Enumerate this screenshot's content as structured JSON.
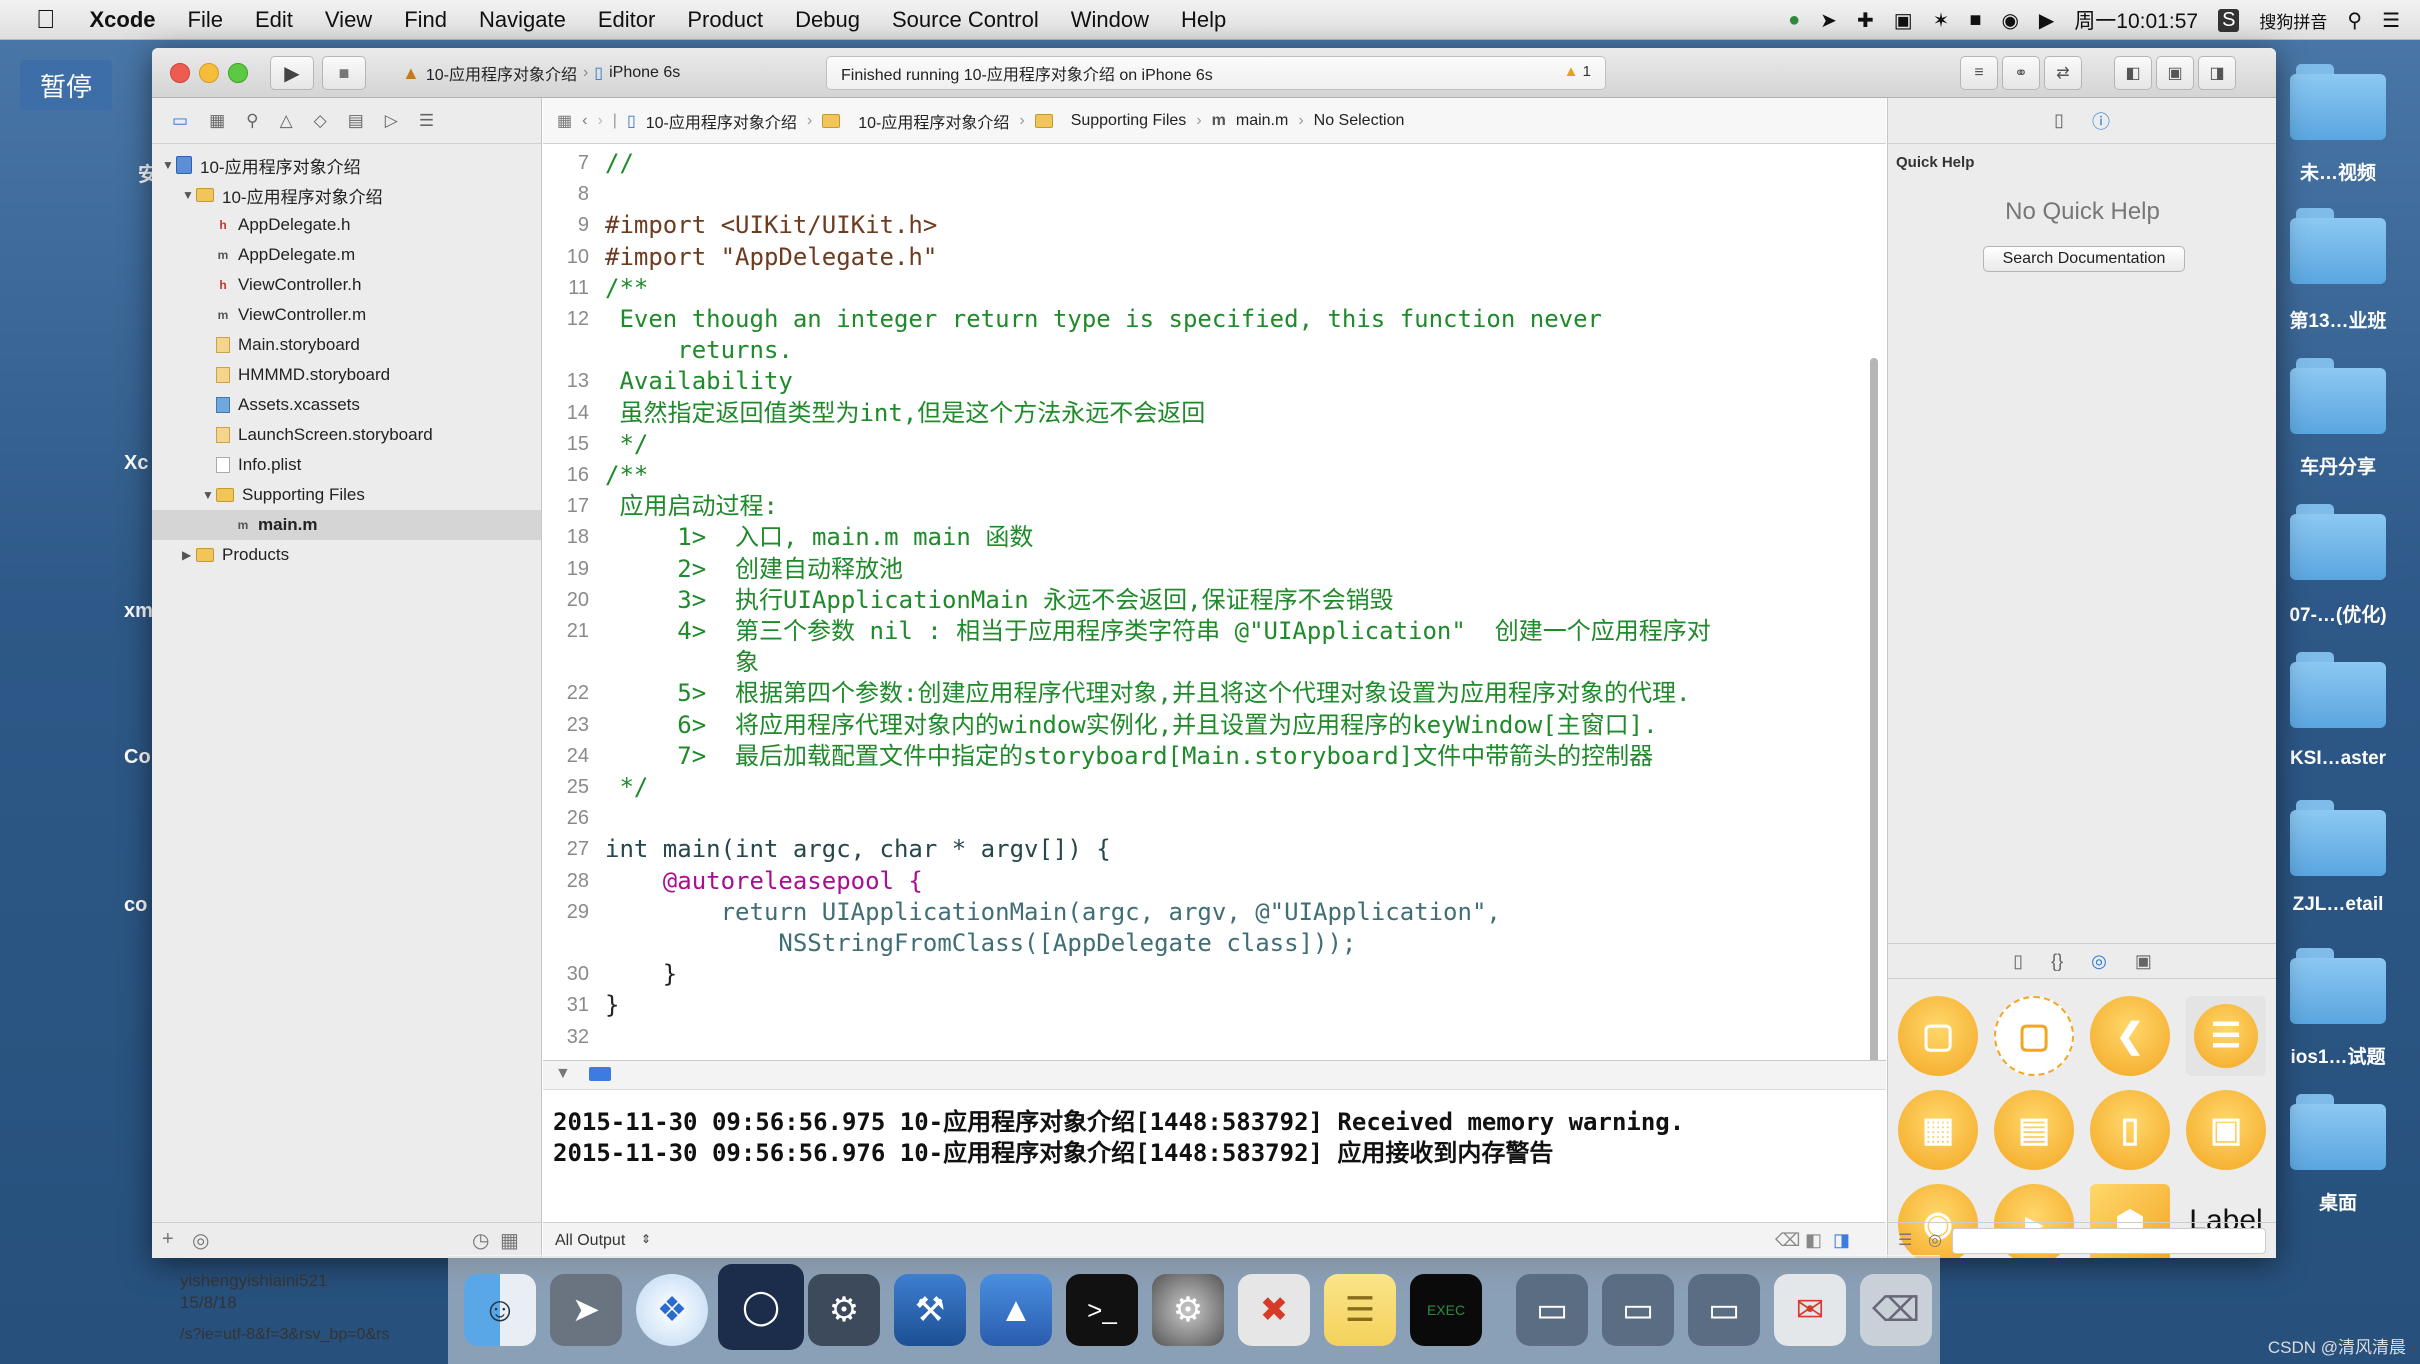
{
  "menubar": {
    "app_name": "Xcode",
    "items": [
      "File",
      "Edit",
      "View",
      "Find",
      "Navigate",
      "Editor",
      "Product",
      "Debug",
      "Source Control",
      "Window",
      "Help"
    ],
    "clock": "周一10:01:57",
    "input_method": "搜狗拼音"
  },
  "desktop": {
    "pause_badge": "暂停",
    "left_labels": [
      "安",
      "Xc",
      "xm",
      "Co",
      "co"
    ],
    "folders": [
      "未…视频",
      "第13…业班",
      "车丹分享",
      "07-…(优化)",
      "KSI…aster",
      "ZJL…etail",
      "ios1…试题",
      "桌面"
    ]
  },
  "toolbar": {
    "scheme_project": "10-应用程序对象介绍",
    "scheme_device": "iPhone 6s",
    "activity_status": "Finished running 10-应用程序对象介绍 on iPhone 6s",
    "warning_count": "1"
  },
  "navigator": {
    "tree": [
      {
        "label": "10-应用程序对象介绍",
        "kind": "project",
        "level": 0,
        "expanded": true
      },
      {
        "label": "10-应用程序对象介绍",
        "kind": "folder",
        "level": 1,
        "expanded": true
      },
      {
        "label": "AppDelegate.h",
        "kind": "h",
        "level": 2
      },
      {
        "label": "AppDelegate.m",
        "kind": "m",
        "level": 2
      },
      {
        "label": "ViewController.h",
        "kind": "h",
        "level": 2
      },
      {
        "label": "ViewController.m",
        "kind": "m",
        "level": 2
      },
      {
        "label": "Main.storyboard",
        "kind": "storyboard",
        "level": 2
      },
      {
        "label": "HMMMD.storyboard",
        "kind": "storyboard",
        "level": 2
      },
      {
        "label": "Assets.xcassets",
        "kind": "assets",
        "level": 2
      },
      {
        "label": "LaunchScreen.storyboard",
        "kind": "storyboard",
        "level": 2
      },
      {
        "label": "Info.plist",
        "kind": "plist",
        "level": 2
      },
      {
        "label": "Supporting Files",
        "kind": "folder",
        "level": 2,
        "expanded": true
      },
      {
        "label": "main.m",
        "kind": "m",
        "level": 3,
        "selected": true
      },
      {
        "label": "Products",
        "kind": "folder",
        "level": 1,
        "expanded": false
      }
    ]
  },
  "jumpbar": {
    "crumbs": [
      "10-应用程序对象介绍",
      "10-应用程序对象介绍",
      "Supporting Files",
      "main.m",
      "No Selection"
    ]
  },
  "code_lines": [
    {
      "n": "7",
      "t": "//",
      "c": "cmt"
    },
    {
      "n": "8",
      "t": "",
      "c": ""
    },
    {
      "n": "9",
      "t": "#import <UIKit/UIKit.h>",
      "c": "pp"
    },
    {
      "n": "10",
      "t": "#import \"AppDelegate.h\"",
      "c": "pp"
    },
    {
      "n": "11",
      "t": "/**",
      "c": "cmt"
    },
    {
      "n": "12",
      "t": " Even though an integer return type is specified, this function never",
      "c": "cmt"
    },
    {
      "n": "",
      "t": "     returns.",
      "c": "cmt"
    },
    {
      "n": "13",
      "t": " Availability",
      "c": "cmt"
    },
    {
      "n": "14",
      "t": " 虽然指定返回值类型为int,但是这个方法永远不会返回",
      "c": "cmt"
    },
    {
      "n": "15",
      "t": " */",
      "c": "cmt"
    },
    {
      "n": "16",
      "t": "/**",
      "c": "cmt"
    },
    {
      "n": "17",
      "t": " 应用启动过程:",
      "c": "cmt"
    },
    {
      "n": "18",
      "t": "     1>  入口, main.m main 函数",
      "c": "cmt"
    },
    {
      "n": "19",
      "t": "     2>  创建自动释放池",
      "c": "cmt"
    },
    {
      "n": "20",
      "t": "     3>  执行UIApplicationMain 永远不会返回,保证程序不会销毁",
      "c": "cmt"
    },
    {
      "n": "21",
      "t": "     4>  第三个参数 nil : 相当于应用程序类字符串 @\"UIApplication\"  创建一个应用程序对",
      "c": "cmt"
    },
    {
      "n": "",
      "t": "         象",
      "c": "cmt"
    },
    {
      "n": "22",
      "t": "     5>  根据第四个参数:创建应用程序代理对象,并且将这个代理对象设置为应用程序对象的代理.",
      "c": "cmt"
    },
    {
      "n": "23",
      "t": "     6>  将应用程序代理对象内的window实例化,并且设置为应用程序的keyWindow[主窗口].",
      "c": "cmt"
    },
    {
      "n": "24",
      "t": "     7>  最后加载配置文件中指定的storyboard[Main.storyboard]文件中带箭头的控制器",
      "c": "cmt"
    },
    {
      "n": "25",
      "t": " */",
      "c": "cmt"
    },
    {
      "n": "26",
      "t": "",
      "c": ""
    },
    {
      "n": "27",
      "t": "int main(int argc, char * argv[]) {",
      "c": "code27"
    },
    {
      "n": "28",
      "t": "    @autoreleasepool {",
      "c": "code28"
    },
    {
      "n": "29",
      "t": "        return UIApplicationMain(argc, argv, @\"UIApplication\",",
      "c": "code29"
    },
    {
      "n": "",
      "t": "            NSStringFromClass([AppDelegate class]));",
      "c": "code29b"
    },
    {
      "n": "30",
      "t": "    }",
      "c": ""
    },
    {
      "n": "31",
      "t": "}",
      "c": ""
    },
    {
      "n": "32",
      "t": "",
      "c": ""
    }
  ],
  "console": {
    "lines": [
      "2015-11-30 09:56:56.975 10-应用程序对象介绍[1448:583792] Received memory warning.",
      "2015-11-30 09:56:56.976 10-应用程序对象介绍[1448:583792] 应用接收到内存警告"
    ],
    "output_filter": "All Output"
  },
  "utilities": {
    "quick_help_title": "Quick Help",
    "no_quick_help": "No Quick Help",
    "search_documentation": "Search Documentation",
    "library_label": "Label"
  },
  "dock": {
    "recent_user": "yishengyishiaini521",
    "recent_date": "15/8/18",
    "recent_text": "/s?ie=utf-8&f=3&rsv_bp=0&rs"
  },
  "watermark": "CSDN @清风清晨"
}
